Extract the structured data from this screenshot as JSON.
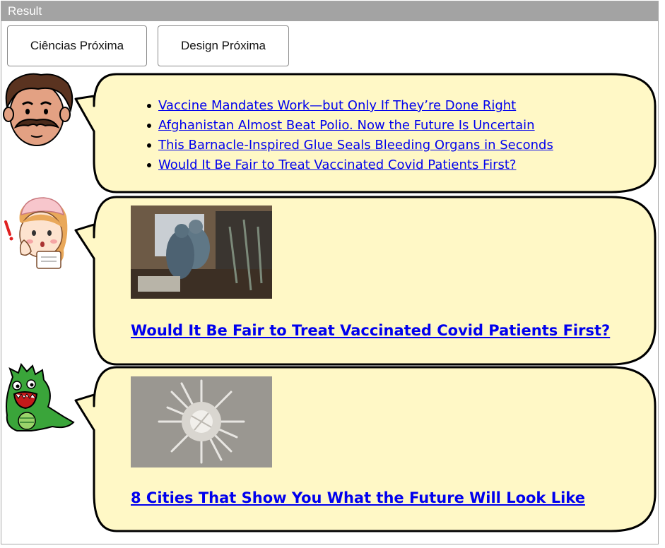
{
  "window": {
    "title": "Result"
  },
  "buttons": {
    "ciencias_label": "Ciências Próxima",
    "design_label": "Design Próxima"
  },
  "colors": {
    "bubble_fill": "#fff8c6",
    "bubble_stroke": "#000000",
    "link": "#0000ee",
    "titlebar": "#a3a3a3"
  },
  "messages": [
    {
      "avatar_icon": "mustache-man-icon",
      "links": [
        "Vaccine Mandates Work—but Only If They’re Done Right",
        "Afghanistan Almost Beat Polio. Now the Future Is Uncertain",
        "This Barnacle-Inspired Glue Seals Bleeding Organs in Seconds",
        "Would It Be Fair to Treat Vaccinated Covid Patients First?"
      ]
    },
    {
      "avatar_icon": "nurse-icon",
      "image_icon": "hospital-photo",
      "title": "Would It Be Fair to Treat Vaccinated Covid Patients First?"
    },
    {
      "avatar_icon": "green-monster-icon",
      "image_icon": "city-sculpture-photo",
      "title": "8 Cities That Show You What the Future Will Look Like"
    }
  ]
}
